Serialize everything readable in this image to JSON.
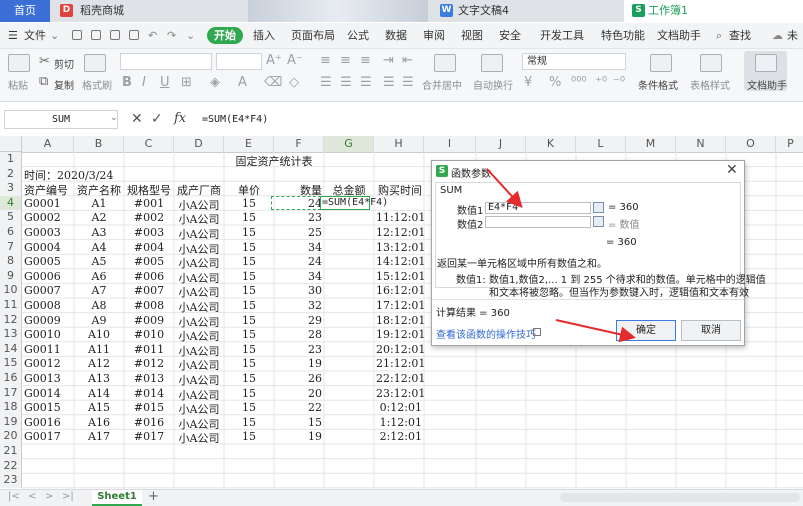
{
  "tabs": {
    "home": "首页",
    "shop": "稻壳商城",
    "doc": "文字文稿4",
    "book": "工作簿1"
  },
  "menu": {
    "file": "文件",
    "start": "开始",
    "insert": "插入",
    "layout": "页面布局",
    "formula": "公式",
    "data": "数据",
    "review": "审阅",
    "view": "视图",
    "security": "安全",
    "devtools": "开发工具",
    "features": "特色功能",
    "assistant": "文档助手",
    "find": "查找",
    "unsync": "未"
  },
  "ribbon": {
    "paste": "粘贴",
    "cut": "剪切",
    "copy": "复制",
    "format_painter": "格式刷",
    "bold": "B",
    "italic": "I",
    "underline": "U",
    "merge_center": "合并居中",
    "wrap": "自动换行",
    "number_format": "常规",
    "percent": "%",
    "conditional": "条件格式",
    "table_style": "表格样式",
    "doc_helper": "文档助手"
  },
  "formula_bar": {
    "name_box": "SUM",
    "fx": "fx",
    "formula": "=SUM(E4*F4)"
  },
  "columns": [
    "A",
    "B",
    "C",
    "D",
    "E",
    "F",
    "G",
    "H",
    "I",
    "J",
    "K",
    "L",
    "M",
    "N",
    "O",
    "P"
  ],
  "active_column": "G",
  "active_row": 4,
  "sheet": {
    "title": "固定资产统计表",
    "date_line": "时间：2020/3/24",
    "headers": [
      "资产编号",
      "资产名称",
      "规格型号",
      "成产厂商",
      "单价",
      "数量",
      "总金额",
      "购买时间"
    ],
    "active_cell_formula": "=SUM(E4*F4)",
    "rows": [
      [
        "G0001",
        "A1",
        "#001",
        "小A公司",
        "15",
        "24",
        "",
        ""
      ],
      [
        "G0002",
        "A2",
        "#002",
        "小A公司",
        "15",
        "23",
        "",
        "11:12:01"
      ],
      [
        "G0003",
        "A3",
        "#003",
        "小A公司",
        "15",
        "25",
        "",
        "12:12:01"
      ],
      [
        "G0004",
        "A4",
        "#004",
        "小A公司",
        "15",
        "34",
        "",
        "13:12:01"
      ],
      [
        "G0005",
        "A5",
        "#005",
        "小A公司",
        "15",
        "24",
        "",
        "14:12:01"
      ],
      [
        "G0006",
        "A6",
        "#006",
        "小A公司",
        "15",
        "34",
        "",
        "15:12:01"
      ],
      [
        "G0007",
        "A7",
        "#007",
        "小A公司",
        "15",
        "30",
        "",
        "16:12:01"
      ],
      [
        "G0008",
        "A8",
        "#008",
        "小A公司",
        "15",
        "32",
        "",
        "17:12:01"
      ],
      [
        "G0009",
        "A9",
        "#009",
        "小A公司",
        "15",
        "29",
        "",
        "18:12:01"
      ],
      [
        "G0010",
        "A10",
        "#010",
        "小A公司",
        "15",
        "28",
        "",
        "19:12:01"
      ],
      [
        "G0011",
        "A11",
        "#011",
        "小A公司",
        "15",
        "23",
        "",
        "20:12:01"
      ],
      [
        "G0012",
        "A12",
        "#012",
        "小A公司",
        "15",
        "19",
        "",
        "21:12:01"
      ],
      [
        "G0013",
        "A13",
        "#013",
        "小A公司",
        "15",
        "26",
        "",
        "22:12:01"
      ],
      [
        "G0014",
        "A14",
        "#014",
        "小A公司",
        "15",
        "20",
        "",
        "23:12:01"
      ],
      [
        "G0015",
        "A15",
        "#015",
        "小A公司",
        "15",
        "22",
        "",
        "0:12:01"
      ],
      [
        "G0016",
        "A16",
        "#016",
        "小A公司",
        "15",
        "15",
        "",
        "1:12:01"
      ],
      [
        "G0017",
        "A17",
        "#017",
        "小A公司",
        "15",
        "19",
        "",
        "2:12:01"
      ]
    ]
  },
  "row_numbers": [
    "1",
    "2",
    "3",
    "4",
    "5",
    "6",
    "7",
    "8",
    "9",
    "10",
    "11",
    "12",
    "13",
    "14",
    "15",
    "16",
    "17",
    "18",
    "19",
    "20",
    "21",
    "22",
    "23"
  ],
  "dialog": {
    "title": "函数参数",
    "func": "SUM",
    "arg1_label": "数值1",
    "arg1_value": "E4*F4",
    "arg1_result": "= 360",
    "arg2_label": "数值2",
    "arg2_result": "= 数值",
    "total_result": "= 360",
    "description": "返回某一单元格区域中所有数值之和。",
    "param_name": "数值1:",
    "param_desc_1": "数值1,数值2,... 1 到 255 个待求和的数值。单元格中的逻辑值",
    "param_desc_2": "和文本将被忽略。但当作为参数键入时，逻辑值和文本有效",
    "calc_result": "计算结果 = 360",
    "help_link": "查看该函数的操作技巧",
    "ok": "确定",
    "cancel": "取消"
  },
  "bottom": {
    "sheet_tab": "Sheet1",
    "add_sheet": "+"
  },
  "colors": {
    "accent_green": "#2fa84f",
    "annotation_red": "#e52b2b",
    "home_tab_blue": "#3b6fd6"
  }
}
